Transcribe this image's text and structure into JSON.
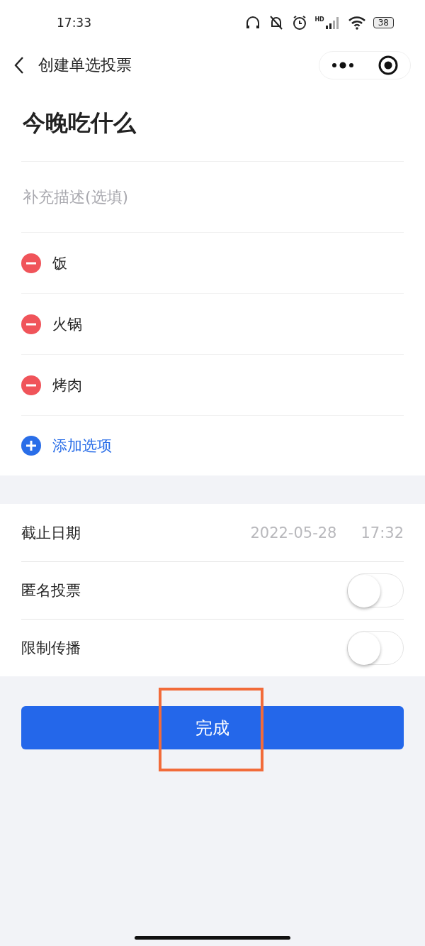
{
  "status_bar": {
    "time": "17:33",
    "signal_label": "HD",
    "battery": "38"
  },
  "nav": {
    "title": "创建单选投票"
  },
  "form": {
    "title_value": "今晚吃什么",
    "description_placeholder": "补充描述(选填)",
    "options": [
      {
        "label": "饭"
      },
      {
        "label": "火锅"
      },
      {
        "label": "烤肉"
      }
    ],
    "add_option": "添加选项"
  },
  "settings": [
    {
      "kind": "date",
      "label": "截止日期",
      "date": "2022-05-28",
      "time": "17:32"
    },
    {
      "kind": "switch",
      "label": "匿名投票",
      "on": false
    },
    {
      "kind": "switch",
      "label": "限制传播",
      "on": false
    }
  ],
  "submit": {
    "label": "完成",
    "highlighted": true
  }
}
